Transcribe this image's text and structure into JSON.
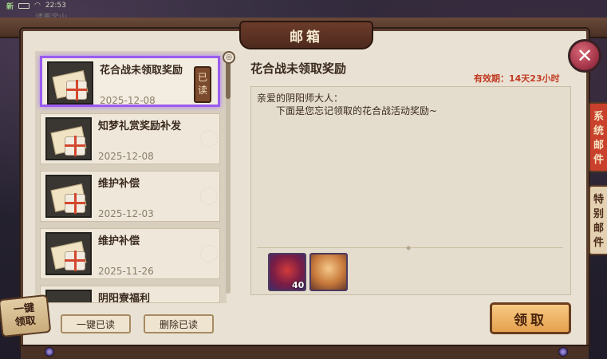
{
  "status": {
    "signal": "新",
    "time": "22:53",
    "ghost_label": "请再定山"
  },
  "window": {
    "title": "邮箱",
    "close": "✕"
  },
  "mail_list": [
    {
      "title": "花合战未领取奖励",
      "date": "2025-12-08",
      "read_tag": "已读",
      "selected": true
    },
    {
      "title": "知梦礼赏奖励补发",
      "date": "2025-12-08"
    },
    {
      "title": "维护补偿",
      "date": "2025-12-03"
    },
    {
      "title": "维护补偿",
      "date": "2025-11-26"
    },
    {
      "title": "阴阳寮福利",
      "date": ""
    }
  ],
  "actions": {
    "claim_all_left": "一键领取",
    "read_all": "一键已读",
    "delete_read": "删除已读",
    "claim": "领取"
  },
  "detail": {
    "title": "花合战未领取奖励",
    "validity": "有效期：14天23小时",
    "greeting": "亲爱的阴阳师大人：",
    "body": "下面是您忘记领取的花合战活动奖励~",
    "rewards": [
      {
        "icon": "red-magatama-icon",
        "count": "40"
      },
      {
        "icon": "shikigami-portrait-icon",
        "count": ""
      }
    ]
  },
  "side_tabs": [
    "系统邮件",
    "特别邮件"
  ]
}
